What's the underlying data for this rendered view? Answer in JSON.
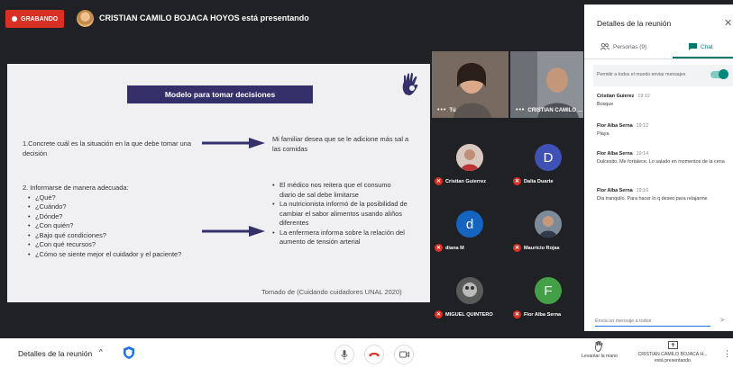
{
  "topbar": {
    "recording_label": "GRABANDO",
    "presenter_text": "CRISTIAN CAMILO BOJACA HOYOS está presentando"
  },
  "slide": {
    "title": "Modelo para tomar decisiones",
    "q1": "1.Concrete cuál es la situación en la que debe tomar una decisión",
    "a1": "Mi familiar desea que se le adicione más sal a las comidas",
    "q2_head": "2. Informarse de manera adecuada:",
    "q2_items": [
      "¿Qué?",
      "¿Cuándo?",
      "¿Dónde?",
      "¿Con quién?",
      "¿Bajo qué condiciones?",
      "¿Con qué recursos?",
      "¿Cómo se siente mejor el cuidador y el paciente?"
    ],
    "a2_items": [
      "El médico nos reitera que el consumo diario de sal debe limitarse",
      "La nutricionista informó de la posibilidad de cambiar el sabor alimentos usando aliños diferentes",
      "La enfermera informa sobre la relación del aumento de tensión arterial"
    ],
    "source": "Tomado de (Cuidando cuidadores UNAL 2020)"
  },
  "videos": {
    "self_label": "Tú",
    "other_label": "CRISTIAN CAMILO ..."
  },
  "participants": [
    {
      "name": "Cristian Guierrez",
      "initial": "",
      "color": "#8d6e63"
    },
    {
      "name": "Dalia Duarte",
      "initial": "D",
      "color": "#3f51b5"
    },
    {
      "name": "diana M",
      "initial": "d",
      "color": "#1565c0"
    },
    {
      "name": "Mauricio Rojas",
      "initial": "",
      "color": "#8d6e63"
    },
    {
      "name": "MIGUEL QUINTERO",
      "initial": "",
      "color": "#555"
    },
    {
      "name": "Flor Alba Serna",
      "initial": "F",
      "color": "#43a047"
    }
  ],
  "panel": {
    "title": "Detalles de la reunión",
    "tab_people": "Personas (9)",
    "tab_chat": "Chat",
    "toggle_label": "Permitir a todos el mundo enviar mensajes",
    "messages": [
      {
        "sender": "Cristian Guierez",
        "time": "19:12",
        "text": "Bosque"
      },
      {
        "sender": "Flor Alba Serna",
        "time": "19:12",
        "text": "Playa"
      },
      {
        "sender": "Flor Alba Serna",
        "time": "19:14",
        "text": "Dulcesito. Me fortalece. Lo salado en momentos de la cena"
      },
      {
        "sender": "Flor Alba Serna",
        "time": "19:16",
        "text": "Día tranquilo. Para hacer lo q deseo para relajarme."
      }
    ],
    "input_placeholder": "Envía un mensaje a todos"
  },
  "bottombar": {
    "details_label": "Detalles de la reunión",
    "raise_hand_label": "Levantar la mano",
    "presenting_name": "CRISTIAN CAMILO BOJACA H...",
    "presenting_status": "está presentando"
  },
  "colors": {
    "accent": "#00796b",
    "record": "#d93025",
    "slide_title_bg": "#34306a",
    "arrow": "#35306a"
  }
}
